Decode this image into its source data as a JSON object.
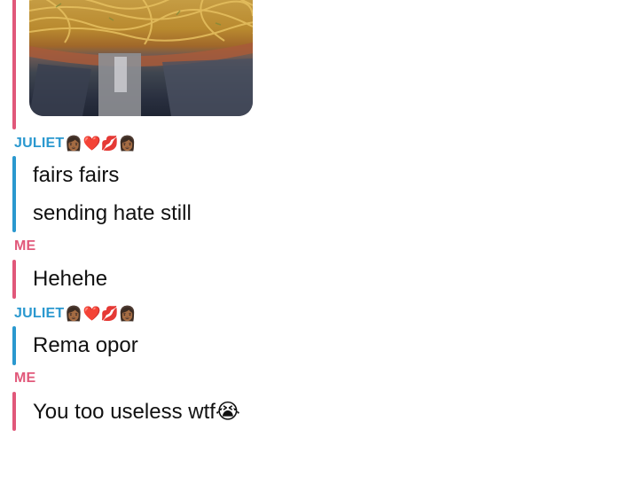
{
  "colors": {
    "juliet_accent": "#2a98cf",
    "me_accent": "#e1587a"
  },
  "thread": [
    {
      "sender": "ME",
      "type": "image",
      "image_description_icon": "photo-noodles"
    },
    {
      "sender": "JULIET",
      "sender_emoji": "👩🏾❤️💋👩🏾",
      "messages": [
        "fairs fairs",
        "sending hate still"
      ]
    },
    {
      "sender": "ME",
      "messages": [
        "Hehehe"
      ]
    },
    {
      "sender": "JULIET",
      "sender_emoji": "👩🏾❤️💋👩🏾",
      "messages": [
        "Rema opor"
      ]
    },
    {
      "sender": "ME",
      "messages": [
        "You too useless wtf😭"
      ]
    }
  ]
}
